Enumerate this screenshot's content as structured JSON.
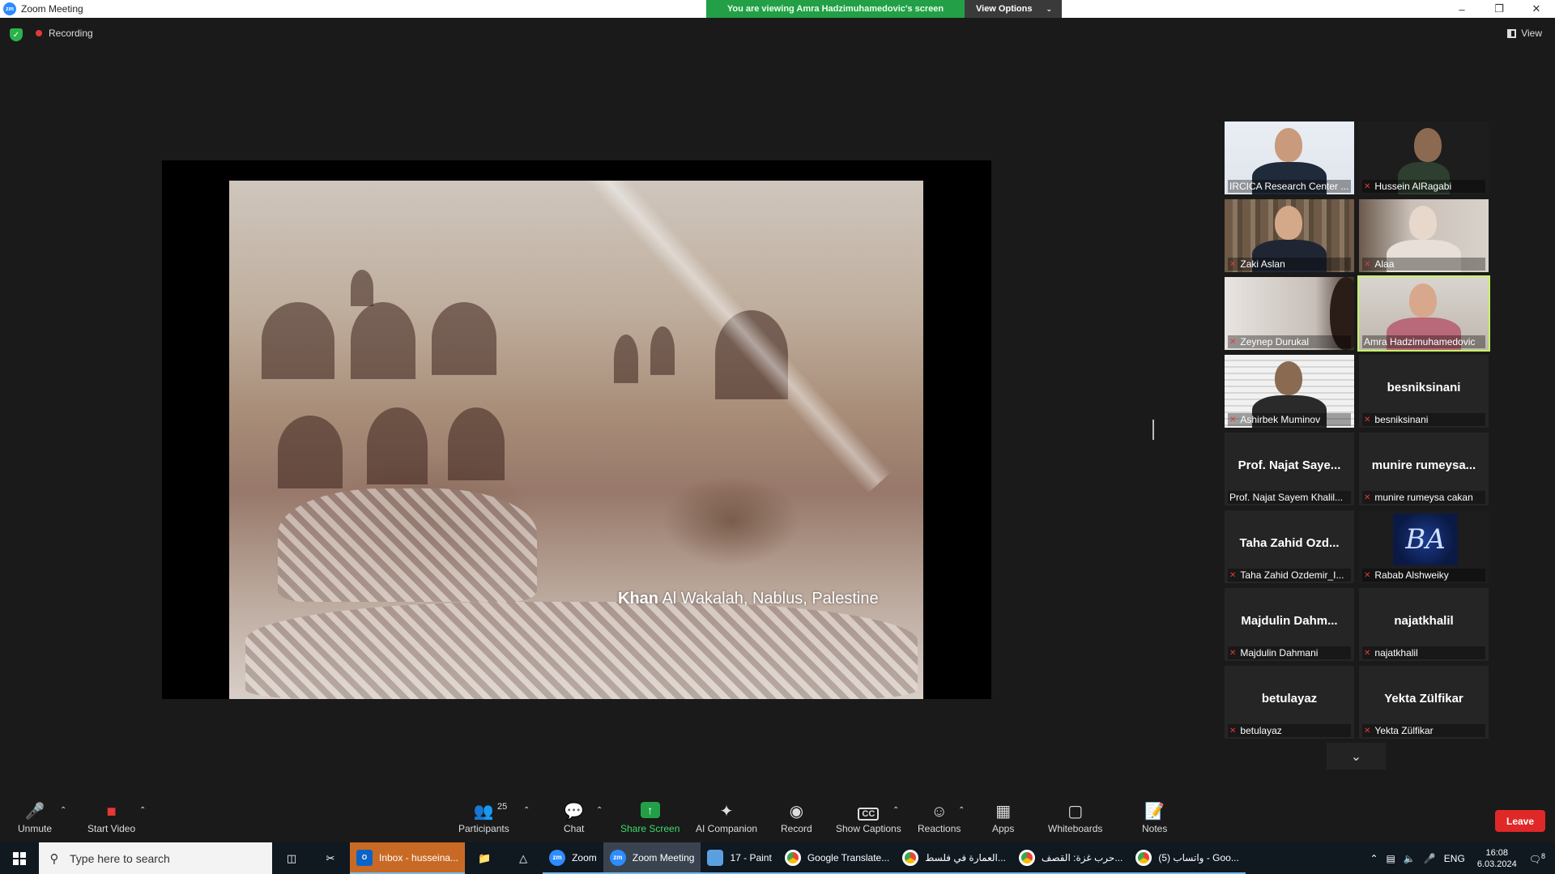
{
  "window": {
    "title": "Zoom Meeting",
    "app_icon": "zm",
    "controls": [
      "minimize-icon",
      "restore-icon",
      "close-icon"
    ]
  },
  "share_banner": {
    "message": "You are viewing Amra Hadzimuhamedovic's screen",
    "options_label": "View Options"
  },
  "status": {
    "recording_label": "Recording",
    "view_label": "View"
  },
  "shared_slide": {
    "caption_bold": "Khan",
    "caption_rest": " Al Wakalah, Nablus, Palestine"
  },
  "participants_tiles": [
    {
      "big_name": "",
      "name": "IRCICA Research Center ...",
      "muted": false,
      "video": "irc",
      "speaking": false
    },
    {
      "big_name": "",
      "name": "Hussein AlRagabi",
      "muted": true,
      "video": "hussein",
      "speaking": false
    },
    {
      "big_name": "",
      "name": "Zaki Aslan",
      "muted": true,
      "video": "zaki",
      "speaking": false
    },
    {
      "big_name": "",
      "name": "Alaa",
      "muted": true,
      "video": "alaa",
      "speaking": false
    },
    {
      "big_name": "",
      "name": "Zeynep Durukal",
      "muted": true,
      "video": "zeynep",
      "speaking": false
    },
    {
      "big_name": "",
      "name": "Amra Hadzimuhamedovic",
      "muted": false,
      "video": "amra",
      "speaking": true
    },
    {
      "big_name": "",
      "name": "Ashirbek Muminov",
      "muted": true,
      "video": "ashirbek",
      "speaking": false
    },
    {
      "big_name": "besniksinani",
      "name": "besniksinani",
      "muted": true,
      "video": "",
      "speaking": false
    },
    {
      "big_name": "Prof. Najat Saye...",
      "name": "Prof. Najat Sayem Khalil...",
      "muted": false,
      "video": "",
      "speaking": false
    },
    {
      "big_name": "munire rumeysa...",
      "name": "munire rumeysa cakan",
      "muted": true,
      "video": "",
      "speaking": false
    },
    {
      "big_name": "Taha Zahid Ozd...",
      "name": "Taha Zahid Ozdemir_I...",
      "muted": true,
      "video": "",
      "speaking": false
    },
    {
      "big_name": "",
      "name": "Rabab Alshweiky",
      "muted": true,
      "video": "rabab",
      "speaking": false
    },
    {
      "big_name": "Majdulin Dahm...",
      "name": "Majdulin Dahmani",
      "muted": true,
      "video": "",
      "speaking": false
    },
    {
      "big_name": "najatkhalil",
      "name": "najatkhalil",
      "muted": true,
      "video": "",
      "speaking": false
    },
    {
      "big_name": "betulayaz",
      "name": "betulayaz",
      "muted": true,
      "video": "",
      "speaking": false
    },
    {
      "big_name": "Yekta Zülfikar",
      "name": "Yekta Zülfikar",
      "muted": true,
      "video": "",
      "speaking": false
    }
  ],
  "rabab_logo_text": "BA",
  "toolbar": {
    "unmute": "Unmute",
    "start_video": "Start Video",
    "participants": "Participants",
    "participants_count": "25",
    "chat": "Chat",
    "share_screen": "Share Screen",
    "ai_companion": "AI Companion",
    "record": "Record",
    "show_captions": "Show Captions",
    "captions_icon_text": "CC",
    "reactions": "Reactions",
    "apps": "Apps",
    "whiteboards": "Whiteboards",
    "notes": "Notes",
    "leave": "Leave"
  },
  "taskbar": {
    "search_placeholder": "Type here to search",
    "apps": [
      {
        "label": "Inbox - husseina...",
        "icon": "outlook",
        "style": "orange"
      },
      {
        "label": "Zoom",
        "icon": "zoom",
        "style": ""
      },
      {
        "label": "Zoom Meeting",
        "icon": "zoom",
        "style": "active"
      },
      {
        "label": "17 - Paint",
        "icon": "paint",
        "style": ""
      },
      {
        "label": "Google Translate...",
        "icon": "chrome",
        "style": ""
      },
      {
        "label": "العمارة في فلسط...",
        "icon": "chrome",
        "style": ""
      },
      {
        "label": "حرب غزة: القصف...",
        "icon": "chrome",
        "style": ""
      },
      {
        "label": "(5) واتساب - Goo...",
        "icon": "chrome",
        "style": ""
      }
    ],
    "language": "ENG",
    "time": "16:08",
    "date": "6.03.2024",
    "notification_count": "8"
  },
  "colors": {
    "banner_green": "#23a047",
    "speaking_outline": "#c7f464",
    "leave_red": "#e02828",
    "zoom_blue": "#2d8cff"
  }
}
